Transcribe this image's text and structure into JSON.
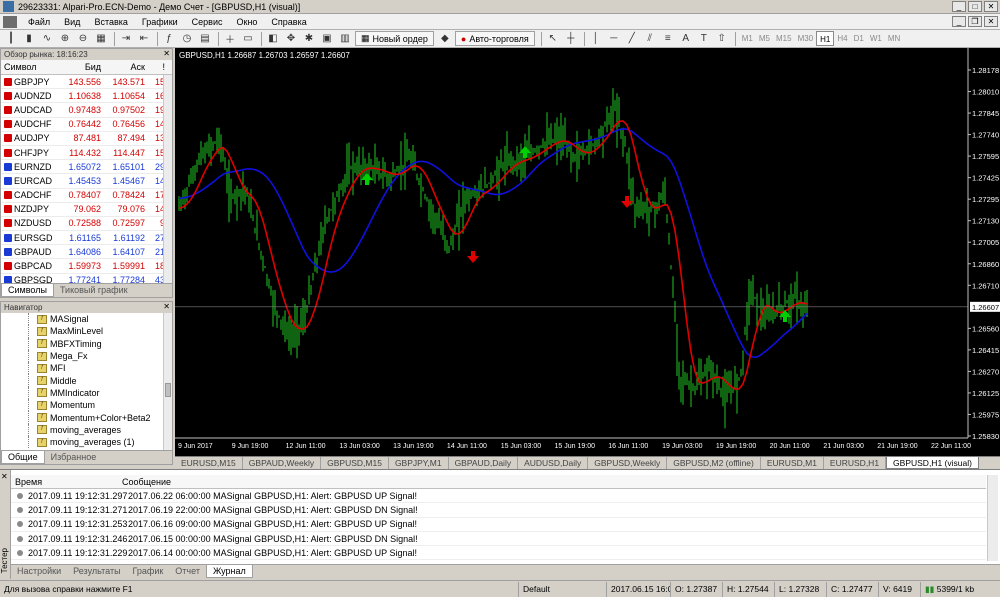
{
  "window": {
    "title": "29623331: Alpari-Pro.ECN-Demo - Демо Счет - [GBPUSD,H1 (visual)]"
  },
  "menu": [
    "Файл",
    "Вид",
    "Вставка",
    "Графики",
    "Сервис",
    "Окно",
    "Справка"
  ],
  "toolbar": {
    "new_order": "Новый ордер",
    "autotrading": "Авто-торговля",
    "timeframes": [
      "M1",
      "M5",
      "M15",
      "M30",
      "H1",
      "H4",
      "D1",
      "W1",
      "MN"
    ],
    "active_timeframe": "H1"
  },
  "market_watch": {
    "title": "Обзор рынка: 18:16:23",
    "headers": {
      "symbol": "Символ",
      "bid": "Бид",
      "ask": "Аск",
      "spread": "!"
    },
    "rows": [
      {
        "symbol": "GBPJPY",
        "bid": "143.556",
        "ask": "143.571",
        "spread": "15",
        "color": "#d40000"
      },
      {
        "symbol": "AUDNZD",
        "bid": "1.10638",
        "ask": "1.10654",
        "spread": "16",
        "color": "#d40000"
      },
      {
        "symbol": "AUDCAD",
        "bid": "0.97483",
        "ask": "0.97502",
        "spread": "19",
        "color": "#d40000"
      },
      {
        "symbol": "AUDCHF",
        "bid": "0.76442",
        "ask": "0.76456",
        "spread": "14",
        "color": "#d40000"
      },
      {
        "symbol": "AUDJPY",
        "bid": "87.481",
        "ask": "87.494",
        "spread": "13",
        "color": "#d40000"
      },
      {
        "symbol": "CHFJPY",
        "bid": "114.432",
        "ask": "114.447",
        "spread": "15",
        "color": "#d40000"
      },
      {
        "symbol": "EURNZD",
        "bid": "1.65072",
        "ask": "1.65101",
        "spread": "29",
        "color": "#1a3ad6"
      },
      {
        "symbol": "EURCAD",
        "bid": "1.45453",
        "ask": "1.45467",
        "spread": "14",
        "color": "#1a3ad6"
      },
      {
        "symbol": "CADCHF",
        "bid": "0.78407",
        "ask": "0.78424",
        "spread": "17",
        "color": "#d40000"
      },
      {
        "symbol": "NZDJPY",
        "bid": "79.062",
        "ask": "79.076",
        "spread": "14",
        "color": "#d40000"
      },
      {
        "symbol": "NZDUSD",
        "bid": "0.72588",
        "ask": "0.72597",
        "spread": "9",
        "color": "#d40000"
      },
      {
        "symbol": "EURSGD",
        "bid": "1.61165",
        "ask": "1.61192",
        "spread": "27",
        "color": "#1a3ad6"
      },
      {
        "symbol": "GBPAUD",
        "bid": "1.64086",
        "ask": "1.64107",
        "spread": "21",
        "color": "#1a3ad6"
      },
      {
        "symbol": "GBPCAD",
        "bid": "1.59973",
        "ask": "1.59991",
        "spread": "18",
        "color": "#d40000"
      },
      {
        "symbol": "GBPSGD",
        "bid": "1.77241",
        "ask": "1.77284",
        "spread": "43",
        "color": "#1a3ad6"
      }
    ],
    "tabs": [
      "Символы",
      "Тиковый график"
    ]
  },
  "navigator": {
    "title": "Навигатор",
    "items": [
      "MASignal",
      "MaxMinLevel",
      "MBFXTiming",
      "Mega_Fx",
      "MFI",
      "Middle",
      "MMIndicator",
      "Momentum",
      "Momentum+Color+Beta2",
      "moving_averages",
      "moving_averages (1)"
    ],
    "tabs": [
      "Общие",
      "Избранное"
    ]
  },
  "chart": {
    "info": "GBPUSD,H1  1.26687 1.26703 1.26597 1.26607",
    "price_labels": [
      "1.28178",
      "1.28010",
      "1.27845",
      "1.27740",
      "1.27595",
      "1.27425",
      "1.27295",
      "1.27130",
      "1.27005",
      "1.26860",
      "1.26710",
      "1.26607",
      "1.26560",
      "1.26415",
      "1.26270",
      "1.26125",
      "1.25975",
      "1.25830"
    ],
    "current_price": "1.26607",
    "time_labels": [
      "9 Jun 2017",
      "9 Jun 19:00",
      "12 Jun 11:00",
      "13 Jun 03:00",
      "13 Jun 19:00",
      "14 Jun 11:00",
      "15 Jun 03:00",
      "15 Jun 19:00",
      "16 Jun 11:00",
      "19 Jun 03:00",
      "19 Jun 19:00",
      "20 Jun 11:00",
      "21 Jun 03:00",
      "21 Jun 19:00",
      "22 Jun 11:00"
    ],
    "colors": {
      "bars": "#1fc61f",
      "ma_fast": "#e00000",
      "ma_slow": "#1010e0",
      "up_arrow": "#00d000",
      "down_arrow": "#e00000"
    }
  },
  "chart_tabs": [
    "EURUSD,M15",
    "GBPAUD,Weekly",
    "GBPUSD,M15",
    "GBPJPY,M1",
    "GBPAUD,Daily",
    "AUDUSD,Daily",
    "GBPUSD,Weekly",
    "GBPUSD,M2 (offline)",
    "EURUSD,M1",
    "EURUSD,H1",
    "GBPUSD,H1 (visual)"
  ],
  "active_chart_tab": "GBPUSD,H1 (visual)",
  "terminal": {
    "side_label": "Тестер",
    "headers": {
      "time": "Время",
      "message": "Сообщение"
    },
    "rows": [
      {
        "time": "2017.09.11 19:12:31.297",
        "message": "2017.06.22 06:00:00  MASignal GBPUSD,H1: Alert: GBPUSD UP Signal!"
      },
      {
        "time": "2017.09.11 19:12:31.271",
        "message": "2017.06.19 22:00:00  MASignal GBPUSD,H1: Alert: GBPUSD DN Signal!"
      },
      {
        "time": "2017.09.11 19:12:31.253",
        "message": "2017.06.16 09:00:00  MASignal GBPUSD,H1: Alert: GBPUSD UP Signal!"
      },
      {
        "time": "2017.09.11 19:12:31.246",
        "message": "2017.06.15 00:00:00  MASignal GBPUSD,H1: Alert: GBPUSD DN Signal!"
      },
      {
        "time": "2017.09.11 19:12:31.229",
        "message": "2017.06.14 00:00:00  MASignal GBPUSD,H1: Alert: GBPUSD UP Signal!"
      }
    ],
    "tabs": [
      "Настройки",
      "Результаты",
      "График",
      "Отчет",
      "Журнал"
    ],
    "active_tab": "Журнал"
  },
  "status": {
    "help": "Для вызова справки нажмите F1",
    "profile": "Default",
    "datetime": "2017.06.15 16:00",
    "open": "O: 1.27387",
    "high": "H: 1.27544",
    "low": "L: 1.27328",
    "close": "C: 1.27477",
    "volume": "V: 6419",
    "traffic": "5399/1 kb"
  }
}
